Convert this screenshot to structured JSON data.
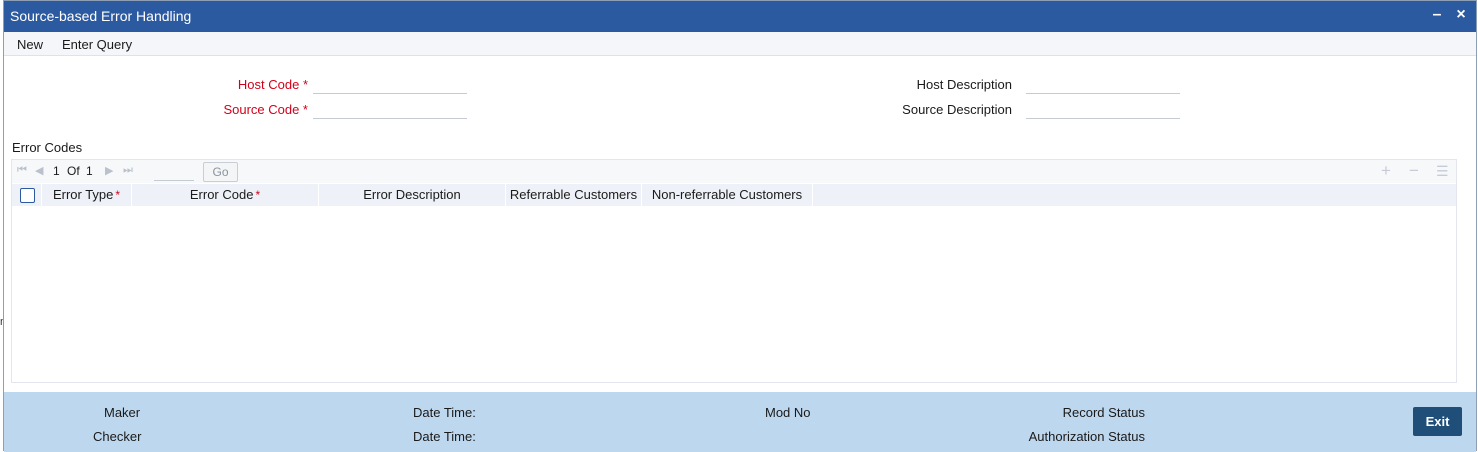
{
  "window": {
    "title": "Source-based Error Handling",
    "minimize_glyph": "–",
    "close_glyph": "×"
  },
  "menu": {
    "new_label": "New",
    "enter_query_label": "Enter Query"
  },
  "form": {
    "host_code_label": "Host Code *",
    "host_code_value": "",
    "source_code_label": "Source Code *",
    "source_code_value": "",
    "host_description_label": "Host Description",
    "host_description_value": "",
    "source_description_label": "Source Description",
    "source_description_value": ""
  },
  "error_codes": {
    "section_title": "Error Codes",
    "pager": {
      "current": "1",
      "of_label": "Of",
      "total": "1",
      "go_label": "Go"
    },
    "toolbar_icons": [
      "add-icon",
      "remove-icon",
      "list-view-icon"
    ],
    "columns": [
      {
        "label": "Error Type",
        "required": true
      },
      {
        "label": "Error Code",
        "required": true
      },
      {
        "label": "Error Description",
        "required": false
      },
      {
        "label": "Referrable Customers",
        "required": false
      },
      {
        "label": "Non-referrable Customers",
        "required": false
      }
    ],
    "required_marker": "*",
    "rows": []
  },
  "footer": {
    "maker_label": "Maker",
    "checker_label": "Checker",
    "date_time_label_1": "Date Time:",
    "date_time_label_2": "Date Time:",
    "mod_no_label": "Mod No",
    "record_status_label": "Record Status",
    "authorization_status_label": "Authorization Status",
    "exit_label": "Exit"
  },
  "colors": {
    "titlebar": "#2c5aa0",
    "required_label": "#d0021b",
    "footer_bg": "#bdd7ee",
    "exit_button": "#1f4e79"
  }
}
